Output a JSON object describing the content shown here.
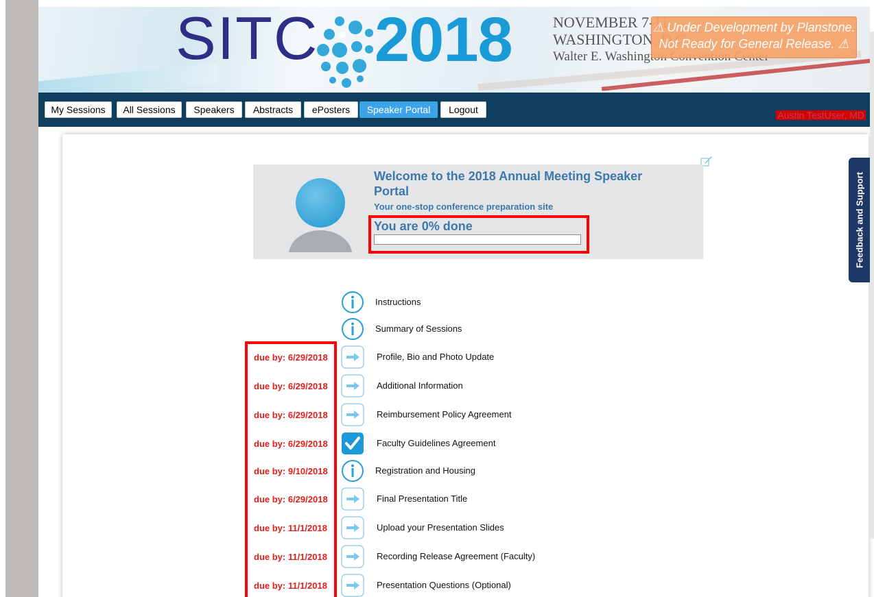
{
  "banner": {
    "logo_text": "SITC",
    "logo_year": "2018",
    "event_lines": [
      "NOVEMBER 7-11",
      "WASHINGTON, D.C.",
      "Walter E. Washington Convention Center"
    ],
    "dev_notice_line1": "⚠ Under Development by Planstone.",
    "dev_notice_line2": "Not Ready for General Release. ⚠",
    "dev_notice_color": "#f5a36a"
  },
  "nav": {
    "items": [
      {
        "label": "My Sessions",
        "active": false
      },
      {
        "label": "All Sessions",
        "active": false
      },
      {
        "label": "Speakers",
        "active": false
      },
      {
        "label": "Abstracts",
        "active": false
      },
      {
        "label": "ePosters",
        "active": false
      },
      {
        "label": "Speaker Portal",
        "active": true
      },
      {
        "label": "Logout",
        "active": false
      }
    ],
    "user_name": "Austin TestUser, MD",
    "bar_color": "#0f3d5d",
    "active_color": "#3da3e8"
  },
  "welcome": {
    "title": "Welcome to the 2018 Annual Meeting Speaker Portal",
    "subtitle": "Your one-stop conference preparation site",
    "progress_text": "You are 0% done",
    "progress_value": 0
  },
  "steps": [
    {
      "due": "",
      "icon": "info-icon",
      "label": "Instructions"
    },
    {
      "due": "",
      "icon": "info-icon",
      "label": "Summary of Sessions"
    },
    {
      "due": "due by: 6/29/2018",
      "icon": "arrow-right-icon",
      "label": "Profile, Bio and Photo Update"
    },
    {
      "due": "due by: 6/29/2018",
      "icon": "arrow-right-icon",
      "label": "Additional Information"
    },
    {
      "due": "due by: 6/29/2018",
      "icon": "arrow-right-icon",
      "label": "Reimbursement Policy Agreement"
    },
    {
      "due": "due by: 6/29/2018",
      "icon": "checkmark-icon",
      "label": "Faculty Guidelines Agreement"
    },
    {
      "due": "due by: 9/10/2018",
      "icon": "info-icon",
      "label": "Registration and Housing"
    },
    {
      "due": "due by: 6/29/2018",
      "icon": "arrow-right-icon",
      "label": "Final Presentation Title"
    },
    {
      "due": "due by: 11/1/2018",
      "icon": "arrow-right-icon",
      "label": "Upload your Presentation Slides"
    },
    {
      "due": "due by: 11/1/2018",
      "icon": "arrow-right-icon",
      "label": "Recording Release Agreement (Faculty)"
    },
    {
      "due": "due by: 11/1/2018",
      "icon": "arrow-right-icon",
      "label": "Presentation Questions (Optional)"
    }
  ],
  "feedback": {
    "label": "Feedback and Support"
  }
}
